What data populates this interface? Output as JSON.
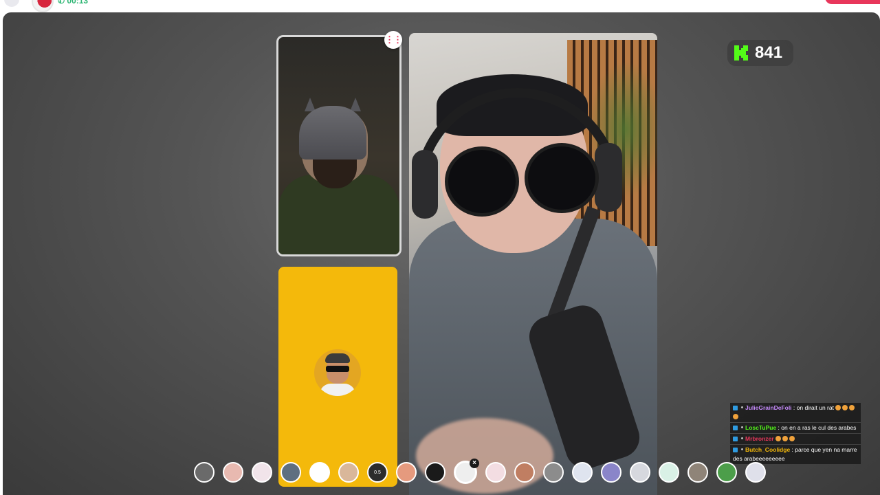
{
  "topbar": {
    "call_timer": "00:13"
  },
  "score": {
    "value": "841",
    "icon": "k-logo-icon",
    "accent": "#53fc18"
  },
  "chat": [
    {
      "user": "JulieGrainDeFoli",
      "user_color": "#c88cff",
      "text": ": on dirait un rat",
      "emojis": 4
    },
    {
      "user": "LoscTuPue",
      "user_color": "#53fc18",
      "text": ": on en a ras le cul des arabes",
      "emojis": 0
    },
    {
      "user": "Mrbronzer",
      "user_color": "#e8365b",
      "text": "",
      "emojis": 3
    },
    {
      "user": "Butch_Coolidge",
      "user_color": "#f4b90b",
      "text": ": parce que yen na marre des arabeeeeeeeee",
      "emojis": 0
    }
  ],
  "filters": [
    {
      "name": "filter-none",
      "color": "#6a6a6a"
    },
    {
      "name": "filter-blush",
      "color": "#e8b9b0"
    },
    {
      "name": "filter-cute-face",
      "color": "#f1e4ea"
    },
    {
      "name": "filter-monkey",
      "color": "#5e6f80"
    },
    {
      "name": "filter-stars",
      "color": "#ffffff"
    },
    {
      "name": "filter-beard",
      "color": "#d9b79a"
    },
    {
      "name": "filter-speed",
      "color": "#2c2c2c",
      "label": "0.5"
    },
    {
      "name": "filter-peach",
      "color": "#e59a7e"
    },
    {
      "name": "filter-devil",
      "color": "#1a1a1a"
    },
    {
      "name": "filter-panda",
      "color": "#eeeeee",
      "selected": true
    },
    {
      "name": "filter-kawaii",
      "color": "#f3dde2"
    },
    {
      "name": "filter-face-swap",
      "color": "#c07e62"
    },
    {
      "name": "filter-sunglasses",
      "color": "#8c8c8c"
    },
    {
      "name": "filter-baby",
      "color": "#dfe4ef"
    },
    {
      "name": "filter-sparkle",
      "color": "#8a85c9"
    },
    {
      "name": "filter-sad",
      "color": "#d6d8de"
    },
    {
      "name": "filter-alien",
      "color": "#d9f1e6"
    },
    {
      "name": "filter-donkey",
      "color": "#8f8478"
    },
    {
      "name": "filter-hulk",
      "color": "#4c9e4a"
    },
    {
      "name": "filter-ghost",
      "color": "#dfe0ea"
    }
  ]
}
